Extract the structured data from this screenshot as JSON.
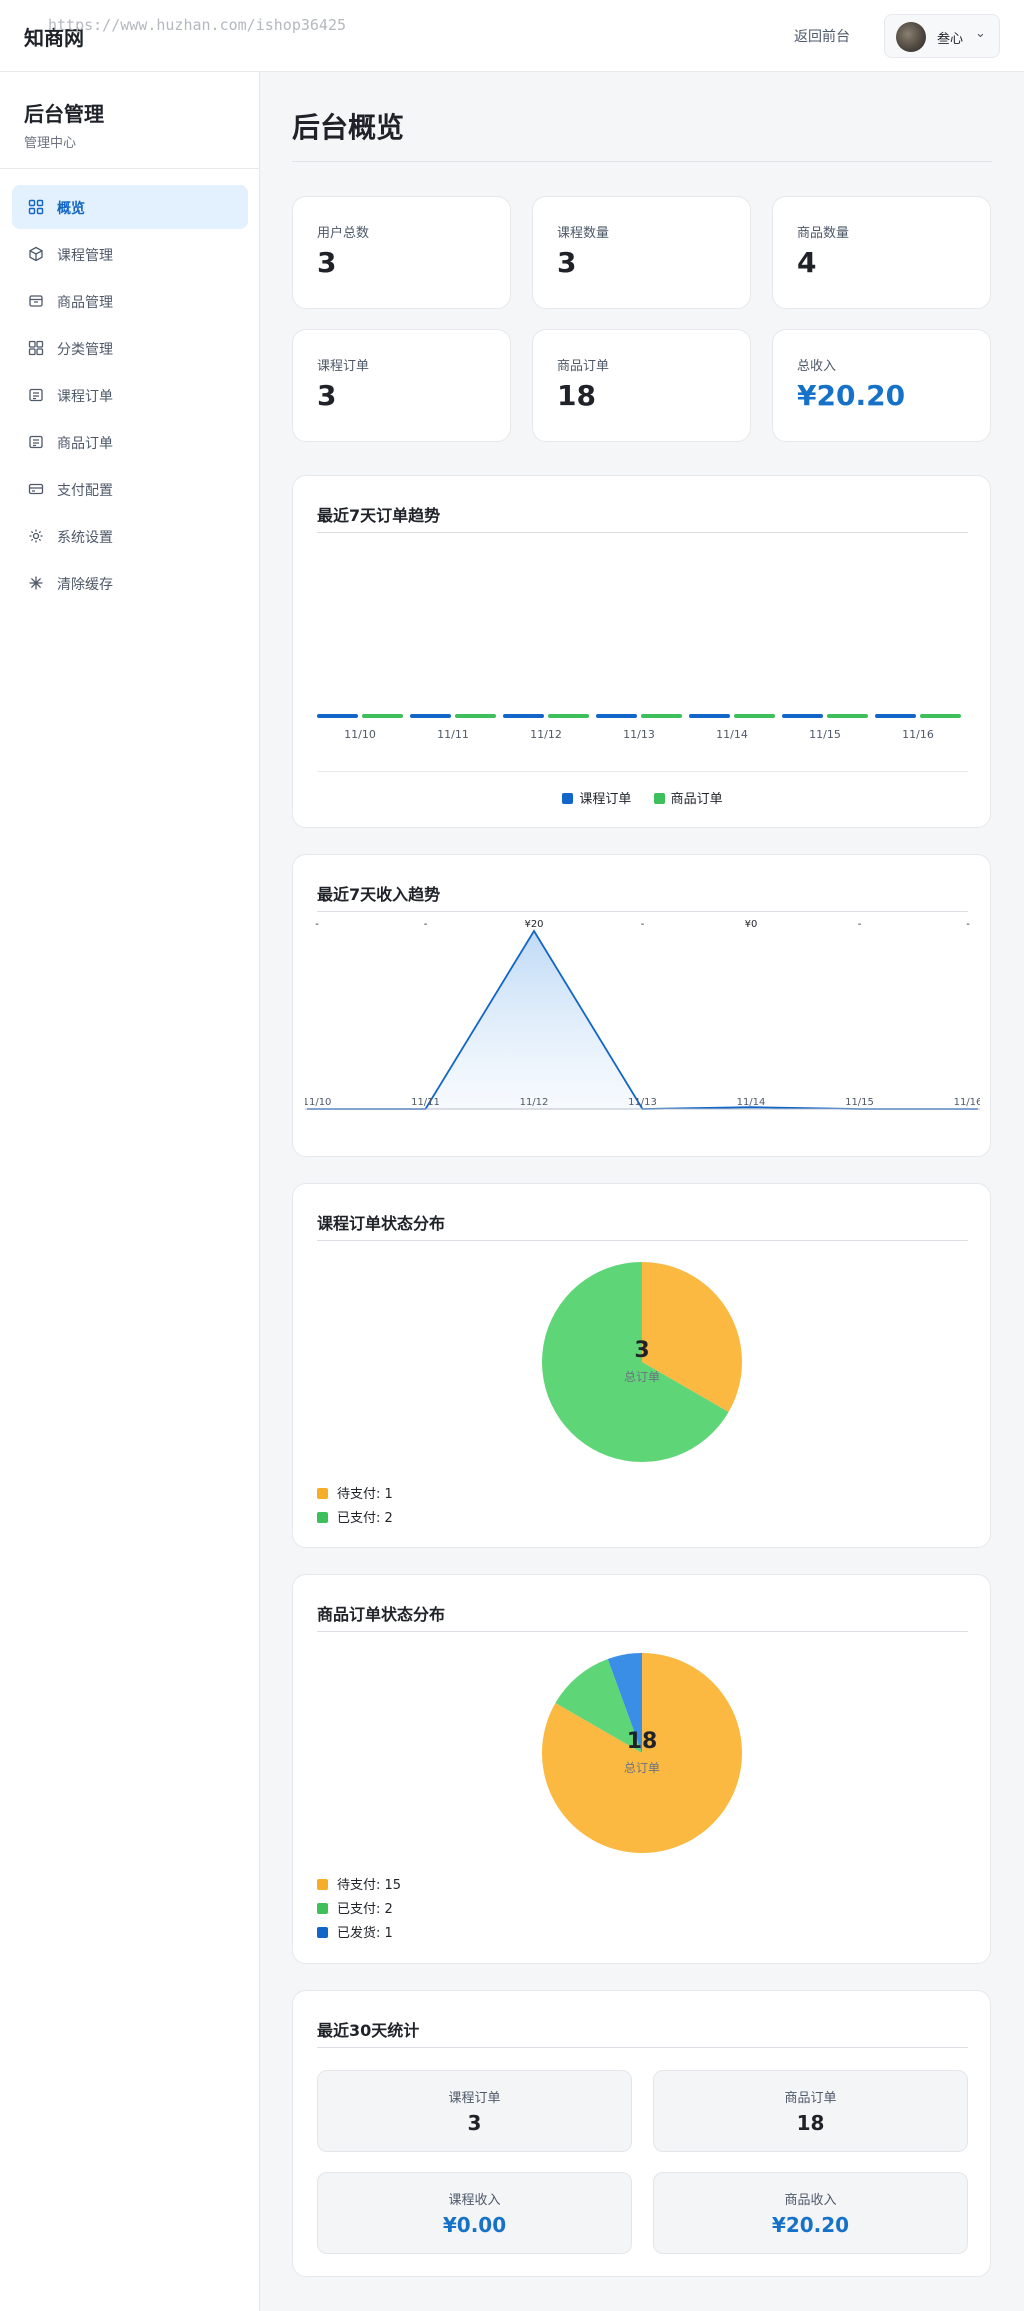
{
  "header": {
    "brand": "知商网",
    "watermark": "https://www.huzhan.com/ishop36425",
    "back_link": "返回前台",
    "user_name": "叁心",
    "chevron": "⌄"
  },
  "sidebar": {
    "title": "后台管理",
    "subtitle": "管理中心",
    "items": [
      {
        "label": "概览",
        "icon": "grid-icon",
        "active": true
      },
      {
        "label": "课程管理",
        "icon": "cube-icon"
      },
      {
        "label": "商品管理",
        "icon": "box-icon"
      },
      {
        "label": "分类管理",
        "icon": "category-icon"
      },
      {
        "label": "课程订单",
        "icon": "order-icon"
      },
      {
        "label": "商品订单",
        "icon": "order-icon"
      },
      {
        "label": "支付配置",
        "icon": "card-icon"
      },
      {
        "label": "系统设置",
        "icon": "gear-icon"
      },
      {
        "label": "清除缓存",
        "icon": "sparkle-icon"
      }
    ]
  },
  "main": {
    "page_title": "后台概览",
    "stats": [
      {
        "label": "用户总数",
        "value": "3"
      },
      {
        "label": "课程数量",
        "value": "3"
      },
      {
        "label": "商品数量",
        "value": "4"
      },
      {
        "label": "课程订单",
        "value": "3"
      },
      {
        "label": "商品订单",
        "value": "18"
      },
      {
        "label": "总收入",
        "value": "¥20.20"
      }
    ],
    "orders_chart_title": "最近7天订单趋势",
    "revenue_chart_title": "最近7天收入趋势",
    "course_status_title": "课程订单状态分布",
    "goods_status_title": "商品订单状态分布",
    "total_orders_label": "总订单",
    "course_status_total": "3",
    "goods_status_total": "18",
    "course_status_legend": [
      "待支付: 1",
      "已支付: 2"
    ],
    "goods_status_legend": [
      "待支付: 15",
      "已支付: 2",
      "已发货: 1"
    ],
    "thirty_day_title": "最近30天统计",
    "thirty_day": [
      {
        "label": "课程订单",
        "value": "3"
      },
      {
        "label": "商品订单",
        "value": "18"
      },
      {
        "label": "课程收入",
        "value": "¥0.00"
      },
      {
        "label": "商品收入",
        "value": "¥20.20"
      }
    ]
  },
  "colors": {
    "course": "#1266c7",
    "goods": "#3dbf5c",
    "pending": "#fbb941",
    "paid": "#5ed576",
    "shipped": "#3a8ee6",
    "accent": "#1672c9"
  },
  "chart_data": [
    {
      "type": "bar",
      "title": "最近7天订单趋势",
      "categories": [
        "11/10",
        "11/11",
        "11/12",
        "11/13",
        "11/14",
        "11/15",
        "11/16"
      ],
      "series": [
        {
          "name": "课程订单",
          "values": [
            0,
            0,
            0,
            0,
            0,
            0,
            0
          ]
        },
        {
          "name": "商品订单",
          "values": [
            0,
            0,
            0,
            0,
            0,
            0,
            0
          ]
        }
      ],
      "legend": "bottom"
    },
    {
      "type": "area",
      "title": "最近7天收入趋势",
      "categories": [
        "11/10",
        "11/11",
        "11/12",
        "11/13",
        "11/14",
        "11/15",
        "11/16"
      ],
      "values": [
        0,
        0,
        20,
        0,
        0.2,
        0,
        0
      ],
      "point_labels": [
        "-",
        "-",
        "¥20",
        "-",
        "¥0",
        "-",
        "-"
      ]
    },
    {
      "type": "pie",
      "title": "课程订单状态分布",
      "categories": [
        "待支付",
        "已支付"
      ],
      "values": [
        1,
        2
      ]
    },
    {
      "type": "pie",
      "title": "商品订单状态分布",
      "categories": [
        "待支付",
        "已支付",
        "已发货"
      ],
      "values": [
        15,
        2,
        1
      ]
    }
  ]
}
